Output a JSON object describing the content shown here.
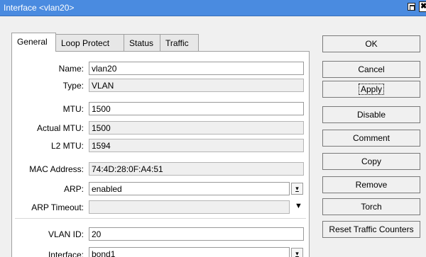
{
  "window": {
    "title": "Interface <vlan20>"
  },
  "tabs": [
    {
      "label": "General"
    },
    {
      "label": "Loop Protect"
    },
    {
      "label": "Status"
    },
    {
      "label": "Traffic"
    }
  ],
  "form": {
    "name": {
      "label": "Name:",
      "value": "vlan20"
    },
    "type": {
      "label": "Type:",
      "value": "VLAN"
    },
    "mtu": {
      "label": "MTU:",
      "value": "1500"
    },
    "actual_mtu": {
      "label": "Actual MTU:",
      "value": "1500"
    },
    "l2_mtu": {
      "label": "L2 MTU:",
      "value": "1594"
    },
    "mac": {
      "label": "MAC Address:",
      "value": "74:4D:28:0F:A4:51"
    },
    "arp": {
      "label": "ARP:",
      "value": "enabled"
    },
    "arp_timeout": {
      "label": "ARP Timeout:",
      "value": ""
    },
    "vlan_id": {
      "label": "VLAN ID:",
      "value": "20"
    },
    "interface": {
      "label": "Interface:",
      "value": "bond1"
    }
  },
  "buttons": {
    "ok": "OK",
    "cancel": "Cancel",
    "apply": "Apply",
    "disable": "Disable",
    "comment": "Comment",
    "copy": "Copy",
    "remove": "Remove",
    "torch": "Torch",
    "reset_traffic": "Reset Traffic Counters"
  },
  "icons": {
    "dropdown": "▾̲",
    "dropdown_plain": "▼",
    "close": "✖"
  },
  "colors": {
    "titlebar": "#4a8be0"
  }
}
